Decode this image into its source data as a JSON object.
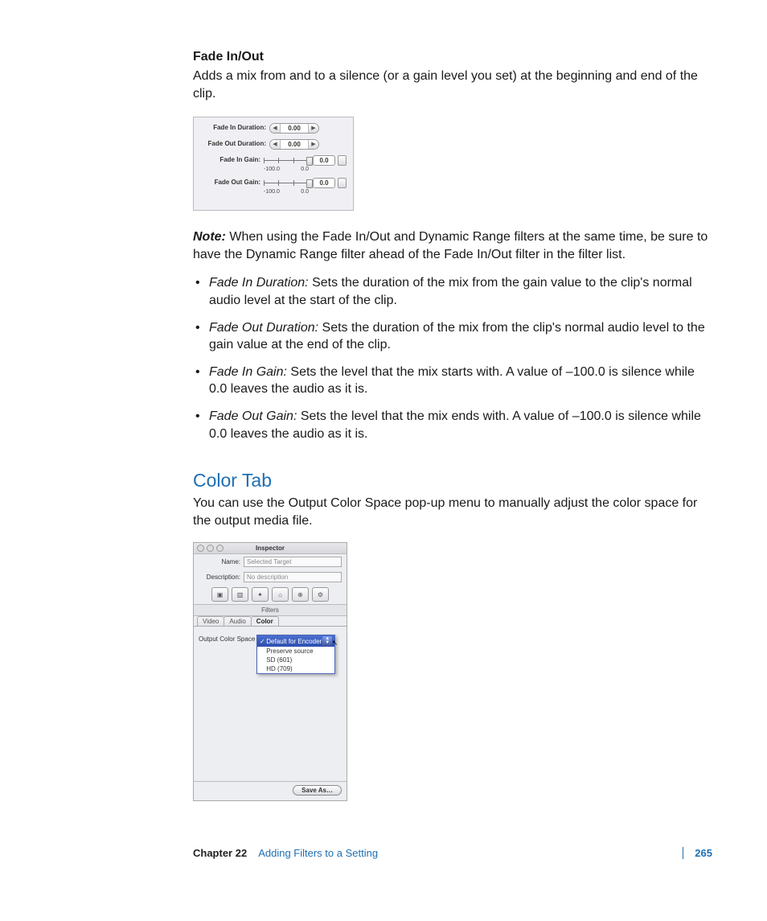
{
  "section1": {
    "heading": "Fade In/Out",
    "para": "Adds a mix from and to a silence (or a gain level you set) at the beginning and end of the clip."
  },
  "fadePanel": {
    "rows": {
      "fadeInDurationLabel": "Fade In Duration:",
      "fadeOutDurationLabel": "Fade Out Duration:",
      "fadeInGainLabel": "Fade In Gain:",
      "fadeOutGainLabel": "Fade Out Gain:",
      "durationValue": "0.00",
      "gainValue": "0.0",
      "scaleMin": "-100.0",
      "scaleMax": "0.0"
    }
  },
  "note": {
    "label": "Note:",
    "text": " When using the Fade In/Out and Dynamic Range filters at the same time, be sure to have the Dynamic Range filter ahead of the Fade In/Out filter in the filter list."
  },
  "bullets": [
    {
      "term": "Fade In Duration:",
      "text": " Sets the duration of the mix from the gain value to the clip's normal audio level at the start of the clip."
    },
    {
      "term": "Fade Out Duration:",
      "text": " Sets the duration of the mix from the clip's normal audio level to the gain value at the end of the clip."
    },
    {
      "term": "Fade In Gain:",
      "text": " Sets the level that the mix starts with. A value of –100.0 is silence while 0.0 leaves the audio as it is."
    },
    {
      "term": "Fade Out Gain:",
      "text": " Sets the level that the mix ends with. A value of –100.0 is silence while 0.0 leaves the audio as it is."
    }
  ],
  "colorTab": {
    "heading": "Color Tab",
    "para": "You can use the Output Color Space pop-up menu to manually adjust the color space for the output media file."
  },
  "inspector": {
    "title": "Inspector",
    "nameLabel": "Name:",
    "nameValue": "Selected Target",
    "descLabel": "Description:",
    "descValue": "No description",
    "filtersBar": "Filters",
    "tabs": {
      "video": "Video",
      "audio": "Audio",
      "color": "Color"
    },
    "ocsLabel": "Output Color Space",
    "popup": {
      "selected": "Default for Encoder",
      "items": [
        "Preserve source",
        "SD (601)",
        "HD (709)"
      ]
    },
    "saveBtn": "Save As…"
  },
  "footer": {
    "chapter": "Chapter 22",
    "title": "Adding Filters to a Setting",
    "page": "265"
  }
}
